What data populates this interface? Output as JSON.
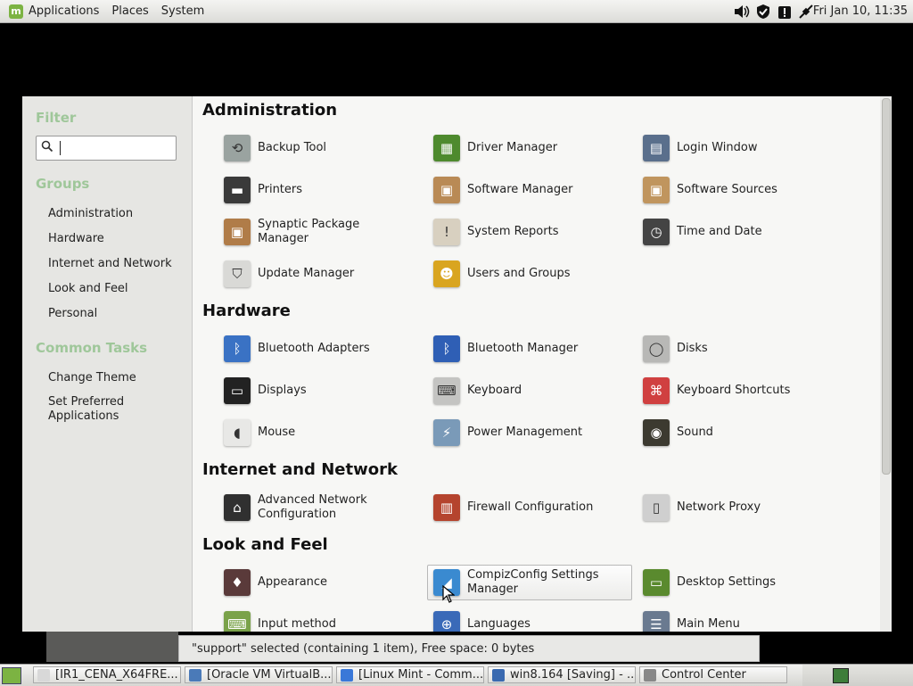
{
  "top_panel": {
    "menus": [
      "Applications",
      "Places",
      "System"
    ],
    "clock": "Fri Jan 10, 11:35",
    "tray_icons": [
      "volume-icon",
      "shield-icon",
      "alert-icon",
      "network-icon"
    ]
  },
  "sidebar": {
    "filter_heading": "Filter",
    "search_placeholder": "",
    "groups_heading": "Groups",
    "groups": [
      "Administration",
      "Hardware",
      "Internet and Network",
      "Look and Feel",
      "Personal"
    ],
    "tasks_heading": "Common Tasks",
    "tasks": [
      "Change Theme",
      "Set Preferred Applications"
    ]
  },
  "sections": [
    {
      "title": "Administration",
      "items": [
        "Backup Tool",
        "Driver Manager",
        "Login Window",
        "Printers",
        "Software Manager",
        "Software Sources",
        "Synaptic Package Manager",
        "System Reports",
        "Time and Date",
        "Update Manager",
        "Users and Groups"
      ]
    },
    {
      "title": "Hardware",
      "items": [
        "Bluetooth Adapters",
        "Bluetooth Manager",
        "Disks",
        "Displays",
        "Keyboard",
        "Keyboard Shortcuts",
        "Mouse",
        "Power Management",
        "Sound"
      ]
    },
    {
      "title": "Internet and Network",
      "items": [
        "Advanced Network Configuration",
        "Firewall Configuration",
        "Network Proxy"
      ]
    },
    {
      "title": "Look and Feel",
      "items": [
        "Appearance",
        "CompizConfig Settings Manager",
        "Desktop Settings",
        "Input method",
        "Languages",
        "Main Menu"
      ]
    }
  ],
  "icons": {
    "Backup Tool": {
      "name": "backup-icon",
      "color": "#9aa3a0",
      "glyph": "⟲"
    },
    "Driver Manager": {
      "name": "chip-icon",
      "color": "#4e8a2e",
      "glyph": "▦"
    },
    "Login Window": {
      "name": "login-window-icon",
      "color": "#5a6f8c",
      "glyph": "▤"
    },
    "Printers": {
      "name": "printer-icon",
      "color": "#3a3a3a",
      "glyph": "▬"
    },
    "Software Manager": {
      "name": "package-icon",
      "color": "#b98a55",
      "glyph": "▣"
    },
    "Software Sources": {
      "name": "package-sources-icon",
      "color": "#c0955e",
      "glyph": "▣"
    },
    "Synaptic Package Manager": {
      "name": "synaptic-icon",
      "color": "#b07c48",
      "glyph": "▣"
    },
    "System Reports": {
      "name": "report-icon",
      "color": "#d8d0c0",
      "glyph": "!"
    },
    "Time and Date": {
      "name": "clock-icon",
      "color": "#444444",
      "glyph": "◷"
    },
    "Update Manager": {
      "name": "update-shield-icon",
      "color": "#d9d9d6",
      "glyph": "⛉"
    },
    "Users and Groups": {
      "name": "users-icon",
      "color": "#d9a520",
      "glyph": "☻"
    },
    "Bluetooth Adapters": {
      "name": "bluetooth-adapter-icon",
      "color": "#3a72c4",
      "glyph": "ᛒ"
    },
    "Bluetooth Manager": {
      "name": "bluetooth-icon",
      "color": "#2f5fb5",
      "glyph": "ᛒ"
    },
    "Disks": {
      "name": "disk-icon",
      "color": "#b8b8b6",
      "glyph": "◯"
    },
    "Displays": {
      "name": "display-icon",
      "color": "#222222",
      "glyph": "▭"
    },
    "Keyboard": {
      "name": "keyboard-icon",
      "color": "#c4c4c2",
      "glyph": "⌨"
    },
    "Keyboard Shortcuts": {
      "name": "keyboard-shortcuts-icon",
      "color": "#d04040",
      "glyph": "⌘"
    },
    "Mouse": {
      "name": "mouse-icon",
      "color": "#e8e8e6",
      "glyph": "◖"
    },
    "Power Management": {
      "name": "power-icon",
      "color": "#7a9ab8",
      "glyph": "⚡"
    },
    "Sound": {
      "name": "speaker-icon",
      "color": "#3c3a30",
      "glyph": "◉"
    },
    "Advanced Network Configuration": {
      "name": "network-config-icon",
      "color": "#303030",
      "glyph": "⌂"
    },
    "Firewall Configuration": {
      "name": "firewall-icon",
      "color": "#b5442e",
      "glyph": "▥"
    },
    "Network Proxy": {
      "name": "proxy-icon",
      "color": "#cfcfcf",
      "glyph": "▯"
    },
    "Appearance": {
      "name": "appearance-icon",
      "color": "#5a3a3a",
      "glyph": "♦"
    },
    "CompizConfig Settings Manager": {
      "name": "compiz-icon",
      "color": "#3a8ad0",
      "glyph": "◢"
    },
    "Desktop Settings": {
      "name": "desktop-icon",
      "color": "#5a8a2e",
      "glyph": "▭"
    },
    "Input method": {
      "name": "input-method-icon",
      "color": "#7aa24a",
      "glyph": "⌨"
    },
    "Languages": {
      "name": "globe-icon",
      "color": "#3a6ab8",
      "glyph": "⊕"
    },
    "Main Menu": {
      "name": "menu-editor-icon",
      "color": "#6a7a90",
      "glyph": "☰"
    }
  },
  "status_bar": "\"support\" selected (containing 1 item), Free space: 0 bytes",
  "taskbar": {
    "buttons": [
      {
        "label": "[IR1_CENA_X64FRE...",
        "icon_color": "#d8d8d8"
      },
      {
        "label": "[Oracle VM VirtualB...",
        "icon_color": "#4a7ab8"
      },
      {
        "label": "[Linux Mint - Comm...",
        "icon_color": "#3a78d8"
      },
      {
        "label": "win8.164 [Saving] - ...",
        "icon_color": "#3a6ab0"
      },
      {
        "label": "Control Center",
        "icon_color": "#888888"
      }
    ]
  },
  "colors": {
    "accent_heading": "#9fc79a",
    "mint_green": "#7cb342"
  }
}
